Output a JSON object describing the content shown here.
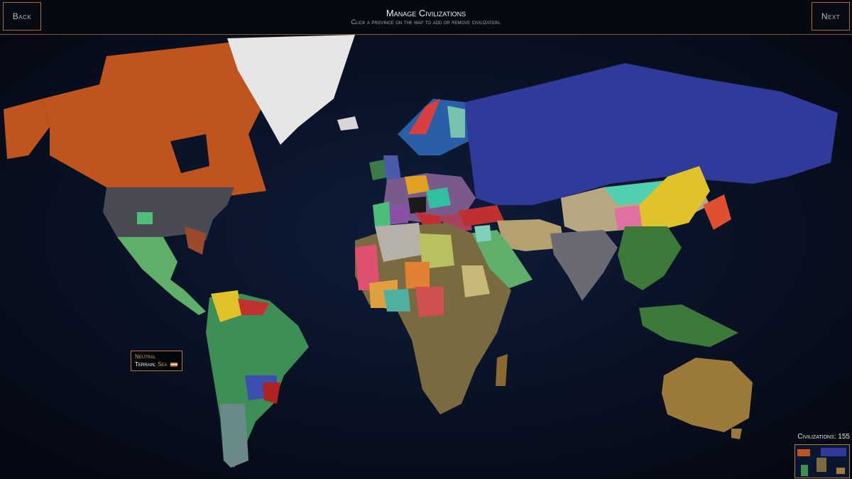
{
  "header": {
    "back_label": "Back",
    "next_label": "Next",
    "title": "Manage Civilizations",
    "subtitle": "Click a province on the map to add or remove civilization."
  },
  "tooltip": {
    "line1": "Neutral",
    "terrain_label": "Terrain:",
    "terrain_value": "Sea"
  },
  "footer": {
    "civ_count_label": "Civilizations: 155"
  },
  "colors": {
    "accent_border": "#b57a2e",
    "ocean": "#0a1226",
    "canada": "#c0541f",
    "russia": "#2f3a9a",
    "greenland": "#e6e6e6",
    "usa": "#4a4a55",
    "china": "#3d7a3a",
    "mongolia_region": "#e0c22a",
    "australia": "#9c7a3a"
  }
}
